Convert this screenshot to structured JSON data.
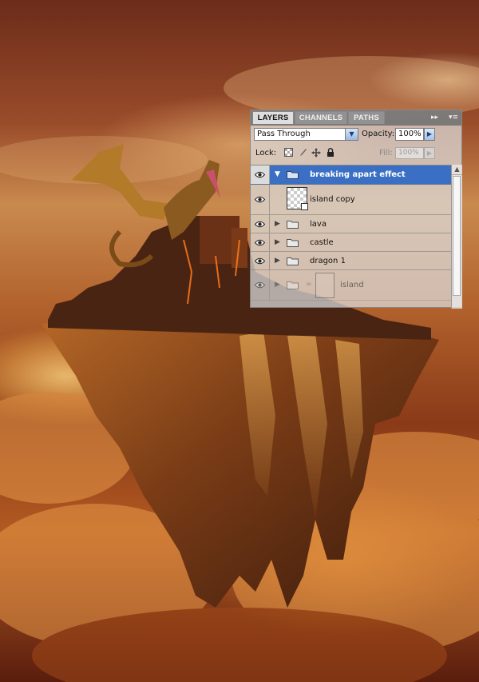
{
  "panel": {
    "tabs": [
      {
        "label": "LAYERS",
        "active": true
      },
      {
        "label": "CHANNELS",
        "active": false
      },
      {
        "label": "PATHS",
        "active": false
      }
    ],
    "collapse_glyph": "▸▸",
    "menu_glyph": "▾≡",
    "blend_mode": "Pass Through",
    "opacity_label": "Opacity:",
    "opacity_value": "100%",
    "lock_label": "Lock:",
    "fill_label": "Fill:",
    "fill_value": "100%",
    "layers": [
      {
        "name": "breaking apart effect",
        "type": "group",
        "expanded": true,
        "selected": true,
        "visible": true
      },
      {
        "name": "island copy",
        "type": "smart-object",
        "selected": false,
        "visible": true
      },
      {
        "name": "lava",
        "type": "group",
        "expanded": false,
        "selected": false,
        "visible": true
      },
      {
        "name": "castle",
        "type": "group",
        "expanded": false,
        "selected": false,
        "visible": true
      },
      {
        "name": "dragon 1",
        "type": "group",
        "expanded": false,
        "selected": false,
        "visible": true
      },
      {
        "name": "island",
        "type": "group",
        "expanded": false,
        "selected": false,
        "visible": true
      }
    ]
  },
  "colors": {
    "selection": "#3a6fc4",
    "sky_dark": "#6b2c1a",
    "cloud_glow": "#ffc860",
    "rock": "#8a4a1e"
  },
  "icons": [
    "eye-icon",
    "folder-icon",
    "lock-transparent-icon",
    "lock-paint-icon",
    "lock-move-icon",
    "lock-all-icon",
    "chain-link-icon",
    "smart-object-badge-icon"
  ]
}
